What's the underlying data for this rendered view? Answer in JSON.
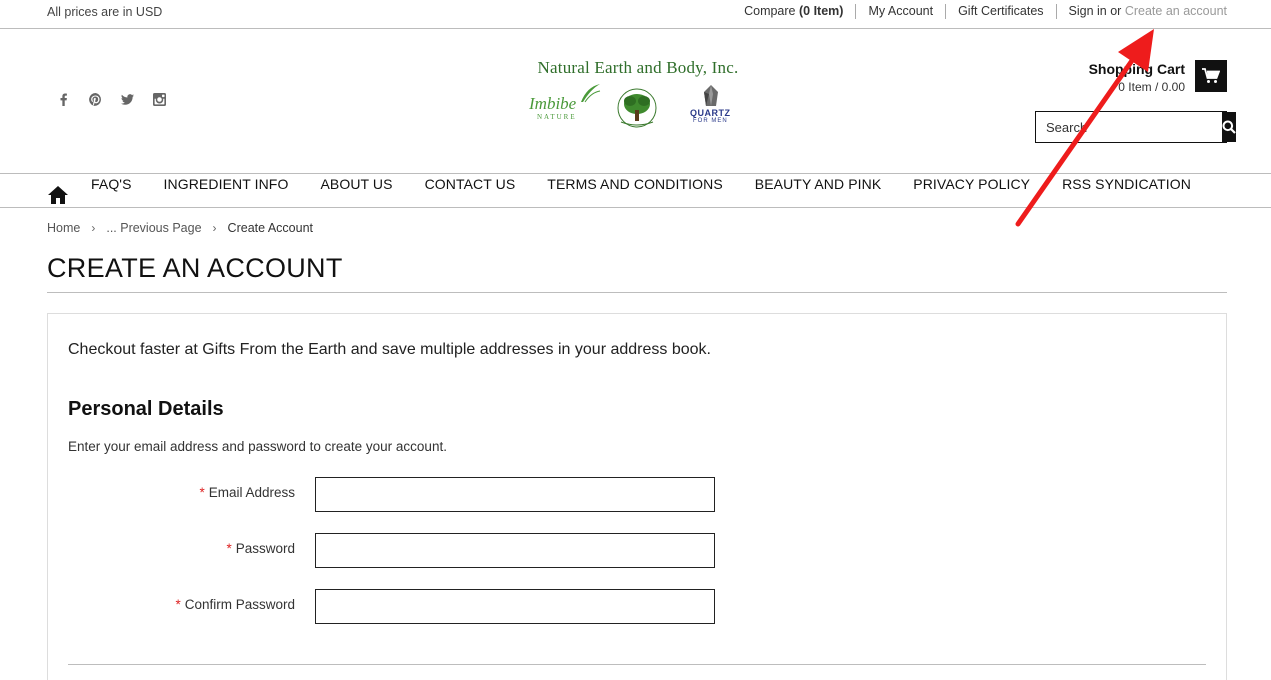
{
  "topbar": {
    "prices_note": "All prices are in USD",
    "links": {
      "compare_prefix": "Compare",
      "compare_count": "(0 Item)",
      "my_account": "My Account",
      "gift_certificates": "Gift Certificates",
      "sign_in": "Sign in",
      "or": "or",
      "create_account": "Create an account"
    }
  },
  "header": {
    "social_icons": [
      "facebook-icon",
      "pinterest-icon",
      "twitter-icon",
      "instagram-icon"
    ],
    "logo": {
      "title": "Natural Earth and Body, Inc.",
      "brand_imbibe": "Imbibe",
      "brand_imbibe_sub": "NATURE",
      "brand_gfte": "GIFTS FROM THE EARTH",
      "brand_quartz": "QUARTZ",
      "brand_quartz_sub": "FOR MEN"
    },
    "cart": {
      "title": "Shopping Cart",
      "summary": "0 Item / 0.00"
    },
    "search": {
      "placeholder": "Search"
    }
  },
  "nav": {
    "items": [
      "FAQ'S",
      "INGREDIENT INFO",
      "ABOUT US",
      "CONTACT US",
      "TERMS AND CONDITIONS",
      "BEAUTY AND PINK",
      "PRIVACY POLICY",
      "RSS SYNDICATION"
    ]
  },
  "breadcrumb": {
    "home": "Home",
    "previous": "... Previous Page",
    "current": "Create Account"
  },
  "page": {
    "title": "CREATE AN ACCOUNT",
    "intro": "Checkout faster at Gifts From the Earth and save multiple addresses in your address book.",
    "section_title": "Personal Details",
    "section_desc": "Enter your email address and password to create your account.",
    "fields": {
      "email_label": "Email Address",
      "password_label": "Password",
      "confirm_label": "Confirm Password",
      "required_mark": "*"
    }
  },
  "colors": {
    "required": "#dd2222",
    "annotation_arrow": "#ee1c1c",
    "logo_green": "#2f6e2a",
    "quartz_blue": "#2b3a8a"
  }
}
